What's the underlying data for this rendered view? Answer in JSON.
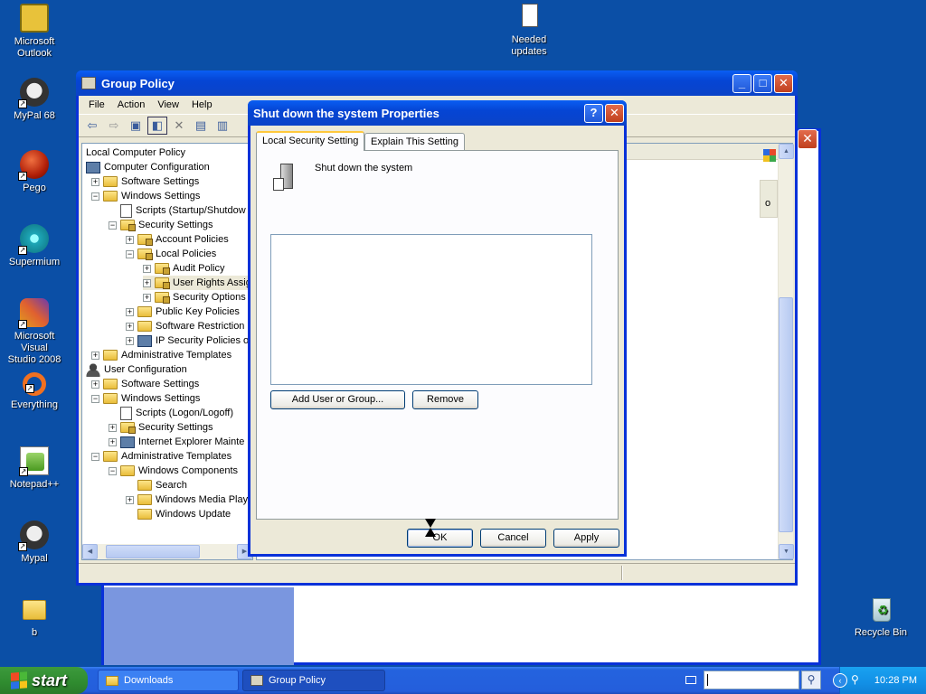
{
  "desktop": {
    "icons": [
      {
        "label": "Microsoft\nOutlook"
      },
      {
        "label": "MyPal 68"
      },
      {
        "label": "Pego"
      },
      {
        "label": "Supermium"
      },
      {
        "label": "Microsoft Visual\nStudio 2008"
      },
      {
        "label": "Everything"
      },
      {
        "label": "Notepad++"
      },
      {
        "label": "Mypal"
      },
      {
        "label": "b"
      },
      {
        "label": "Needed\nupdates"
      },
      {
        "label": "Recycle Bin"
      }
    ]
  },
  "gp_window": {
    "title": "Group Policy",
    "menu": [
      "File",
      "Action",
      "View",
      "Help"
    ],
    "tree": [
      {
        "label": "Local Computer Policy"
      },
      {
        "label": "Computer Configuration"
      },
      {
        "label": "Software Settings"
      },
      {
        "label": "Windows Settings"
      },
      {
        "label": "Scripts (Startup/Shutdow"
      },
      {
        "label": "Security Settings"
      },
      {
        "label": "Account Policies"
      },
      {
        "label": "Local Policies"
      },
      {
        "label": "Audit Policy"
      },
      {
        "label": "User Rights Assig"
      },
      {
        "label": "Security Options"
      },
      {
        "label": "Public Key Policies"
      },
      {
        "label": "Software Restriction"
      },
      {
        "label": "IP Security Policies or"
      },
      {
        "label": "Administrative Templates"
      },
      {
        "label": "User Configuration"
      },
      {
        "label": "Software Settings"
      },
      {
        "label": "Windows Settings"
      },
      {
        "label": "Scripts (Logon/Logoff)"
      },
      {
        "label": "Security Settings"
      },
      {
        "label": "Internet Explorer Mainte"
      },
      {
        "label": "Administrative Templates"
      },
      {
        "label": "Windows Components"
      },
      {
        "label": "Search"
      },
      {
        "label": "Windows Media Playe"
      },
      {
        "label": "Windows Update"
      }
    ],
    "right_fragment": "o"
  },
  "dialog": {
    "title": "Shut down the system Properties",
    "help_label": "?",
    "tabs": [
      "Local Security Setting",
      "Explain This Setting"
    ],
    "policy_name": "Shut down the system",
    "add_button": "Add User or Group...",
    "remove_button": "Remove",
    "ok_button": "OK",
    "cancel_button": "Cancel",
    "apply_button": "Apply"
  },
  "taskbar": {
    "start_label": "start",
    "tasks": [
      "Downloads",
      "Group Policy"
    ],
    "clock": "10:28 PM"
  },
  "colors": {
    "desktop": "#0b4fa6",
    "titlebar": "#0545d4",
    "taskbar": "#245edc",
    "start": "#2f8b2f"
  }
}
